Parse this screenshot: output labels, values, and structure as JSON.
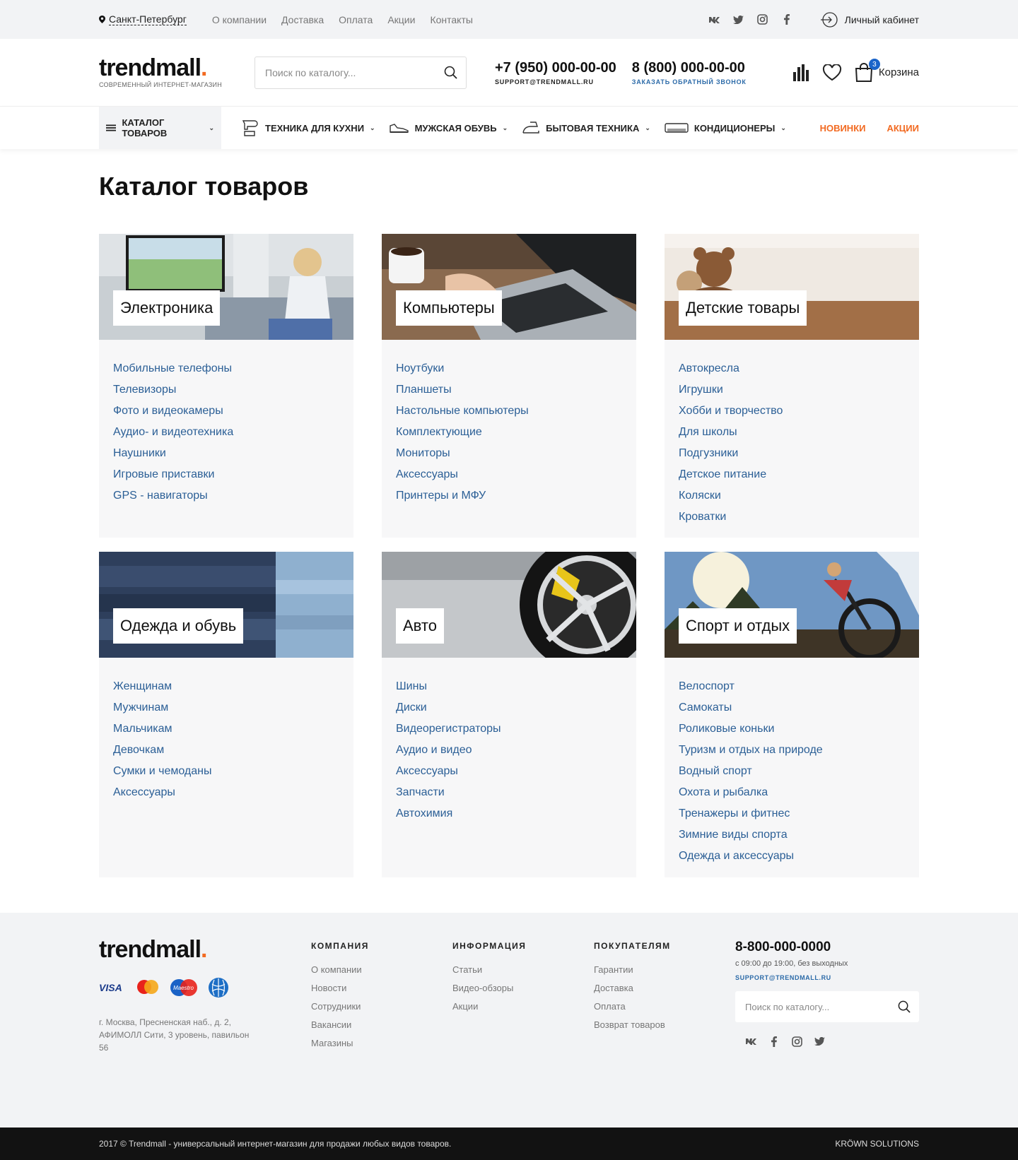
{
  "topbar": {
    "city": "Санкт-Петербург",
    "links": [
      "О компании",
      "Доставка",
      "Оплата",
      "Акции",
      "Контакты"
    ],
    "social": [
      "vk-icon",
      "twitter-icon",
      "instagram-icon",
      "facebook-icon"
    ],
    "cabinet": "Личный кабинет"
  },
  "header": {
    "logo": "trendmall",
    "logo_dot": ".",
    "tagline": "СОВРЕМЕННЫЙ ИНТЕРНЕТ-МАГАЗИН",
    "search_placeholder": "Поиск по каталогу...",
    "phone1": "+7 (950) 000-00-00",
    "phone1_sub": "SUPPORT@TRENDMALL.RU",
    "phone2": "8 (800) 000-00-00",
    "phone2_sub": "ЗАКАЗАТЬ ОБРАТНЫЙ ЗВОНОК",
    "cart_label": "Корзина",
    "cart_count": "3"
  },
  "nav": {
    "catalog": "КАТАЛОГ ТОВАРОВ",
    "items": [
      "ТЕХНИКА ДЛЯ КУХНИ",
      "МУЖСКАЯ ОБУВЬ",
      "БЫТОВАЯ ТЕХНИКА",
      "КОНДИЦИОНЕРЫ"
    ],
    "right": [
      "НОВИНКИ",
      "АКЦИИ"
    ]
  },
  "page_title": "Каталог товаров",
  "categories": [
    {
      "name": "Электроника",
      "links": [
        "Мобильные телефоны",
        "Телевизоры",
        "Фото и видеокамеры",
        "Аудио- и видеотехника",
        "Наушники",
        "Игровые приставки",
        "GPS - навигаторы"
      ]
    },
    {
      "name": "Компьютеры",
      "links": [
        "Ноутбуки",
        "Планшеты",
        "Настольные компьютеры",
        "Комплектующие",
        "Мониторы",
        "Аксессуары",
        "Принтеры и МФУ"
      ]
    },
    {
      "name": "Детские товары",
      "links": [
        "Автокресла",
        "Игрушки",
        "Хобби и творчество",
        "Для школы",
        "Подгузники",
        "Детское питание",
        "Коляски",
        "Кроватки"
      ]
    },
    {
      "name": "Одежда и обувь",
      "links": [
        "Женщинам",
        "Мужчинам",
        "Мальчикам",
        "Девочкам",
        "Сумки и чемоданы",
        "Аксессуары"
      ]
    },
    {
      "name": "Авто",
      "links": [
        "Шины",
        "Диски",
        "Видеорегистраторы",
        "Аудио и видео",
        "Аксессуары",
        "Запчасти",
        "Автохимия"
      ]
    },
    {
      "name": "Спорт и отдых",
      "links": [
        "Велоспорт",
        "Самокаты",
        "Роликовые коньки",
        "Туризм и отдых на природе",
        "Водный спорт",
        "Охота и рыбалка",
        "Тренажеры и фитнес",
        "Зимние виды спорта",
        "Одежда и аксессуары"
      ]
    }
  ],
  "footer": {
    "logo": "trendmall",
    "logo_dot": ".",
    "payments": [
      "VISA",
      "mastercard",
      "Maestro",
      "webmoney"
    ],
    "address": "г. Москва, Пресненская наб., д. 2, АФИМОЛЛ Сити, 3 уровень, павильон 56",
    "columns": [
      {
        "title": "КОМПАНИЯ",
        "links": [
          "О компании",
          "Новости",
          "Сотрудники",
          "Вакансии",
          "Магазины"
        ]
      },
      {
        "title": "ИНФОРМАЦИЯ",
        "links": [
          "Статьи",
          "Видео-обзоры",
          "Акции"
        ]
      },
      {
        "title": "ПОКУПАТЕЛЯМ",
        "links": [
          "Гарантии",
          "Доставка",
          "Оплата",
          "Возврат товаров"
        ]
      }
    ],
    "phone": "8-800-000-0000",
    "hours": "с 09:00 до 19:00, без выходных",
    "email": "SUPPORT@TRENDMALL.RU",
    "search_placeholder": "Поиск по каталогу...",
    "social": [
      "vk-icon",
      "facebook-icon",
      "instagram-icon",
      "twitter-icon"
    ]
  },
  "bottom": {
    "copyright": "2017 © Trendmall - универсальный интернет-магазин для продажи любых видов товаров.",
    "credit": "KRÖWN SOLUTIONS"
  },
  "colors": {
    "accent": "#f26a21",
    "link": "#2b5f96",
    "badge": "#1a64c9"
  }
}
